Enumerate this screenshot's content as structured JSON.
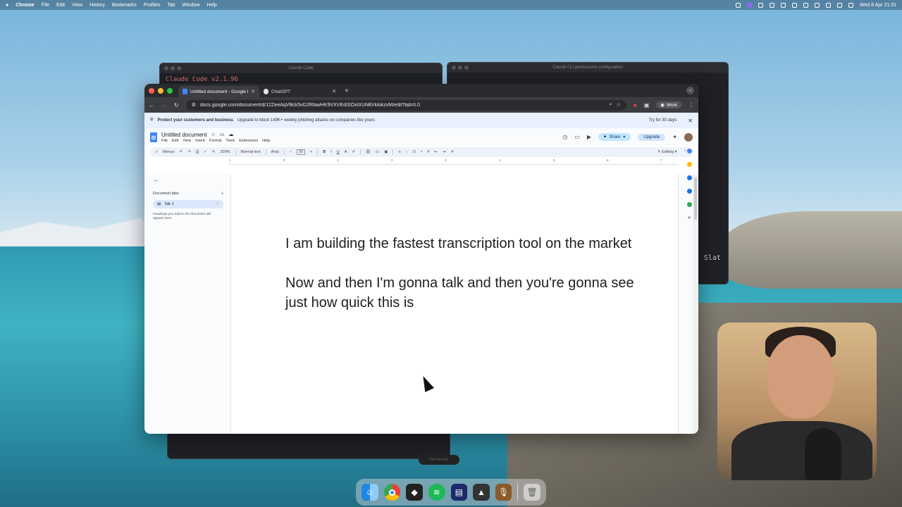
{
  "menubar": {
    "apple": "",
    "app": "Chrome",
    "items": [
      "File",
      "Edit",
      "View",
      "History",
      "Bookmarks",
      "Profiles",
      "Tab",
      "Window",
      "Help"
    ],
    "datetime": "Wed 8 Apr  21:31"
  },
  "terminal1": {
    "title": "Claude Code",
    "line": "Claude Code v2.1.96"
  },
  "terminal2": {
    "title": "Claude CLI permissions configuration",
    "sidetext": "Slat"
  },
  "chrome": {
    "tabs": [
      {
        "label": "Untitled document - Google Docs",
        "active": true
      },
      {
        "label": "ChatGPT",
        "active": false
      }
    ],
    "new_tab": "+",
    "url": "docs.google.com/document/d/12ZeeAqVBck5vG2RfawHK9VXVEdISOxtXUhBVkIokzvM/edit?tab=t.0",
    "profile": "Work"
  },
  "banner": {
    "bold": "Protect your customers and business",
    "text": "Upgrade to block 149K+ weekly phishing attacks on companies like yours",
    "try": "Try for 30 days",
    "close": "✕"
  },
  "docs": {
    "title": "Untitled document",
    "menus": [
      "File",
      "Edit",
      "View",
      "Insert",
      "Format",
      "Tools",
      "Extensions",
      "Help"
    ],
    "share": "Share",
    "upgrade": "Upgrade",
    "toolbar": {
      "menus": "Menus",
      "zoom": "200%",
      "style": "Normal text",
      "font": "Arial",
      "size": "20",
      "mode": "Editing"
    },
    "ruler": [
      "1",
      "1",
      "2",
      "3",
      "4",
      "5",
      "6",
      "7"
    ],
    "outline": {
      "heading": "Document tabs",
      "add": "+",
      "tab": "Tab 1",
      "hint": "Headings you add to the document will appear here."
    },
    "body": [
      "I am building the fastest transcription tool on the market",
      "Now and then I'm gonna talk and then you're gonna see just how quick this is"
    ]
  },
  "colors": {
    "chrome_dark": "#2a2b2e",
    "docs_blue": "#4285f4",
    "share_blue": "#c2e7ff"
  }
}
